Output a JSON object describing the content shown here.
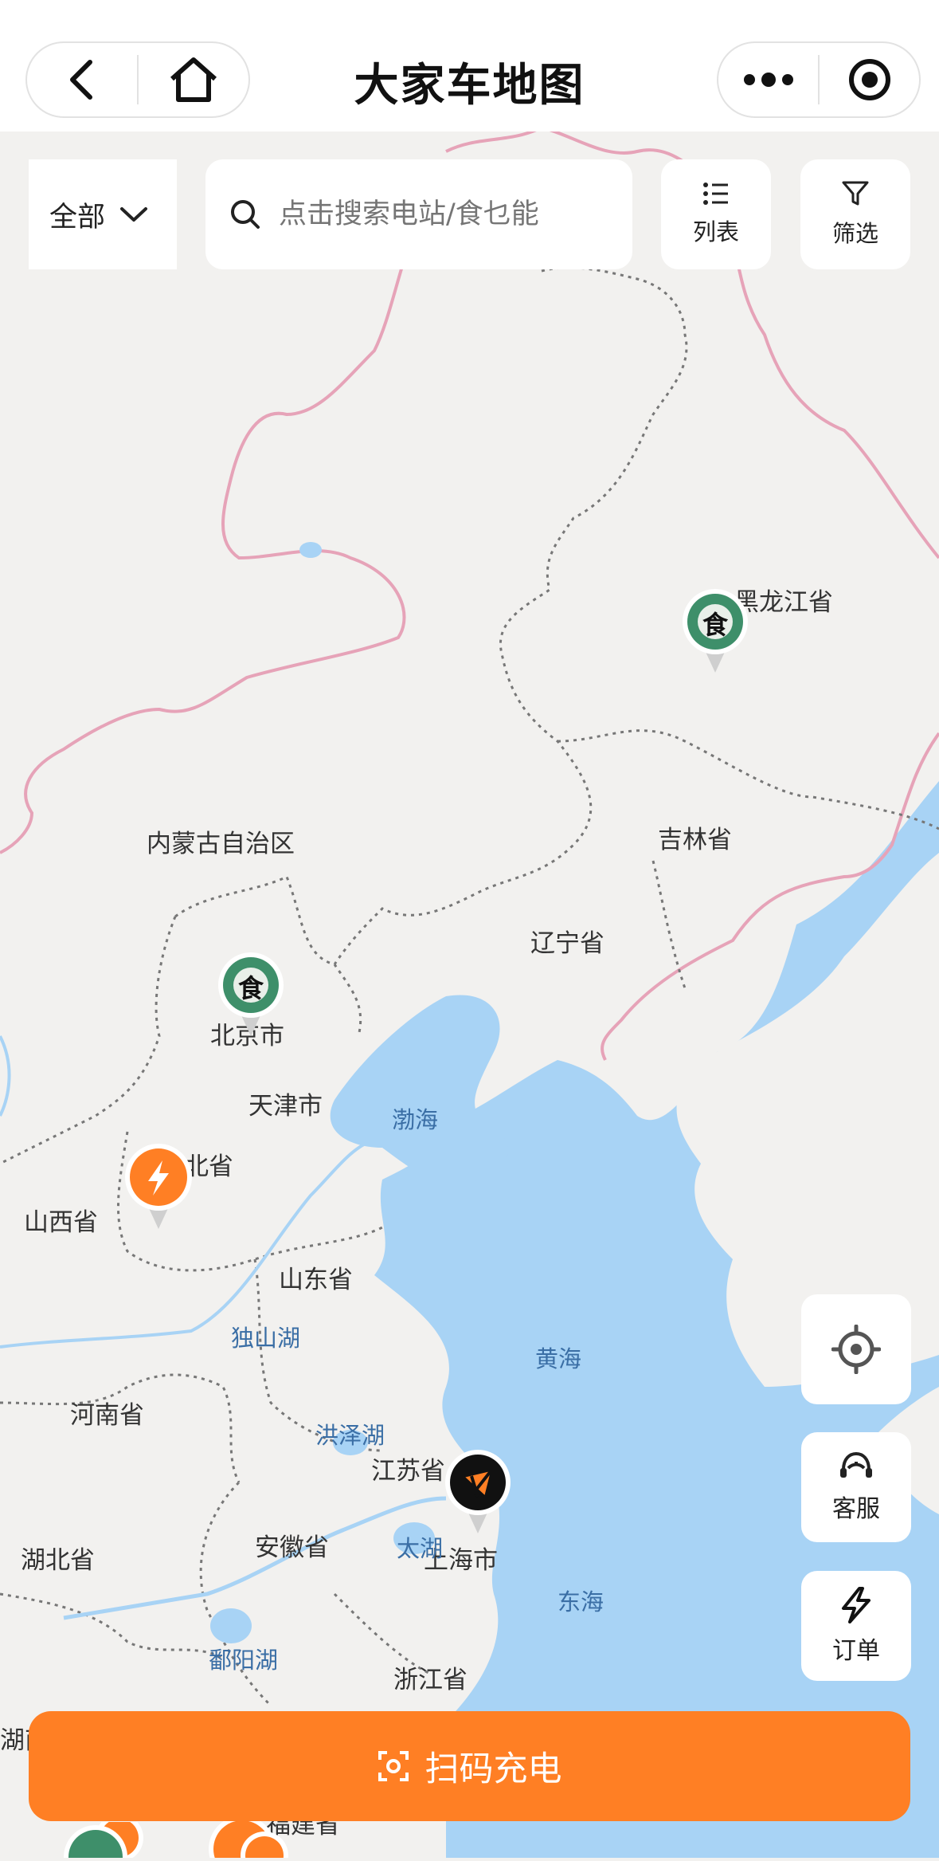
{
  "nav": {
    "title": "大家车地图"
  },
  "filters": {
    "category": "全部",
    "search_placeholder": "点击搜索电站/食乜能",
    "list_label": "列表",
    "filter_label": "筛选"
  },
  "map_labels": {
    "heilongjiang": "黑龙江省",
    "jilin": "吉林省",
    "neimenggu": "内蒙古自治区",
    "liaoning": "辽宁省",
    "beijing": "北京市",
    "tianjin": "天津市",
    "hebei": "河北省",
    "shanxi": "山西省",
    "shandong": "山东省",
    "henan": "河南省",
    "jiangsu": "江苏省",
    "anhui": "安徽省",
    "shanghai": "上海市",
    "hubei": "湖北省",
    "zhejiang": "浙江省",
    "hunan": "湖南",
    "fujian": "福建省",
    "bohai": "渤海",
    "huanghai": "黄海",
    "donghai": "东海",
    "dushanhu": "独山湖",
    "hongzehu": "洪泽湖",
    "taihu": "太湖",
    "poyanghu": "鄱阳湖"
  },
  "pin_glyph": "食",
  "side_buttons": {
    "service_label": "客服",
    "orders_label": "订单"
  },
  "scan_button": {
    "label": "扫码充电"
  },
  "colors": {
    "accent": "#ff7f24",
    "food_pin": "#3e8f6a",
    "water": "#a8d3f5",
    "land": "#f2f1ef",
    "border": "#e6a3b8"
  }
}
